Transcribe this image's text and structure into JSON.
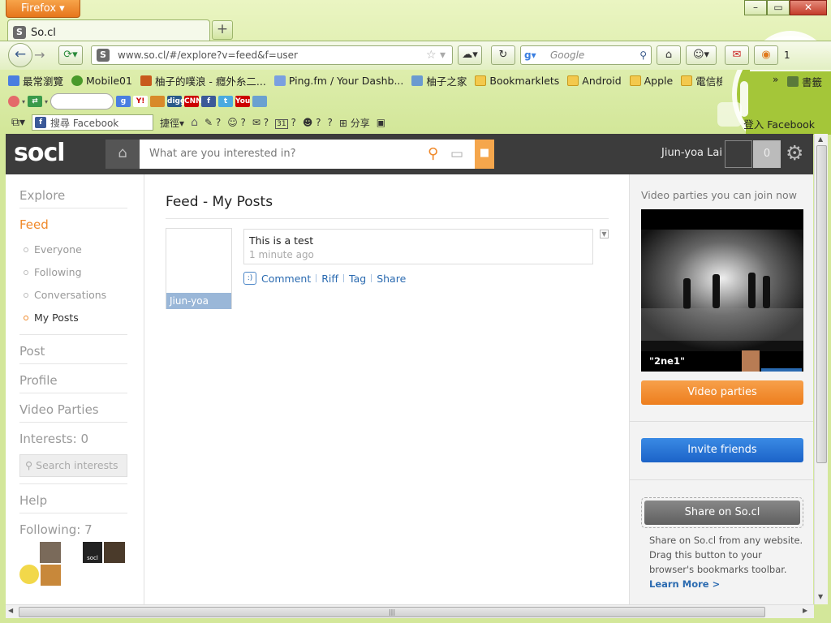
{
  "browser": {
    "menu_label": "Firefox",
    "tab_title": "So.cl",
    "url": "www.so.cl/#/explore?v=feed&f=user",
    "search_placeholder": "Google",
    "counter": "1",
    "bookmarks": [
      "最常瀏覽",
      "Mobile01",
      "柚子的噗浪 - 癮外糸二...",
      "Ping.fm / Your Dashb...",
      "柚子之家",
      "Bookmarklets",
      "Android",
      "Apple",
      "電信檢驗查詢"
    ],
    "bookmarks_more": "»",
    "bookmarks_menu": "書籤",
    "fb_search_placeholder": "搜尋 Facebook",
    "shortcut_label": "捷徑",
    "share_label": "分享",
    "q": "?",
    "cal_num": "31",
    "fb_login": "登入 Facebook",
    "window_controls": [
      "–",
      "▭",
      "✕"
    ]
  },
  "header": {
    "logo": "socl",
    "query_placeholder": "What are you interested in?",
    "user_name": "Jiun-yoa Lai",
    "notification_count": "0"
  },
  "sidebar": {
    "explore": "Explore",
    "feed": "Feed",
    "feed_items": [
      "Everyone",
      "Following",
      "Conversations",
      "My Posts"
    ],
    "post": "Post",
    "profile": "Profile",
    "video_parties": "Video Parties",
    "interests": "Interests: 0",
    "search_interests_placeholder": "Search interests",
    "help": "Help",
    "following": "Following: 7"
  },
  "feed": {
    "title": "Feed - My Posts",
    "post": {
      "author": "Jiun-yoa",
      "text": "This is a test",
      "time": "1 minute ago",
      "smile": ":)",
      "actions": [
        "Comment",
        "Riff",
        "Tag",
        "Share"
      ]
    }
  },
  "right_panel": {
    "title": "Video parties you can join now",
    "video_title": "\"2ne1\"",
    "video_parties_button": "Video parties",
    "invite_button": "Invite friends",
    "share_button": "Share on So.cl",
    "share_text": "Share on So.cl from any website. Drag this button to your browser's bookmarks toolbar.",
    "learn_more": "Learn More >"
  },
  "colors": {
    "accent_orange": "#f0892a",
    "link_blue": "#2a6ab0",
    "header_dark": "#3c3c3c",
    "browser_green": "#d3e79a"
  },
  "icons": [
    "firefox-menu-icon",
    "back-icon",
    "forward-icon",
    "reload-icon",
    "home-icon",
    "bookmark-star-icon",
    "rss-icon",
    "search-icon",
    "gear-icon",
    "comment-bubble-icon",
    "lock-icon",
    "android-icon"
  ]
}
